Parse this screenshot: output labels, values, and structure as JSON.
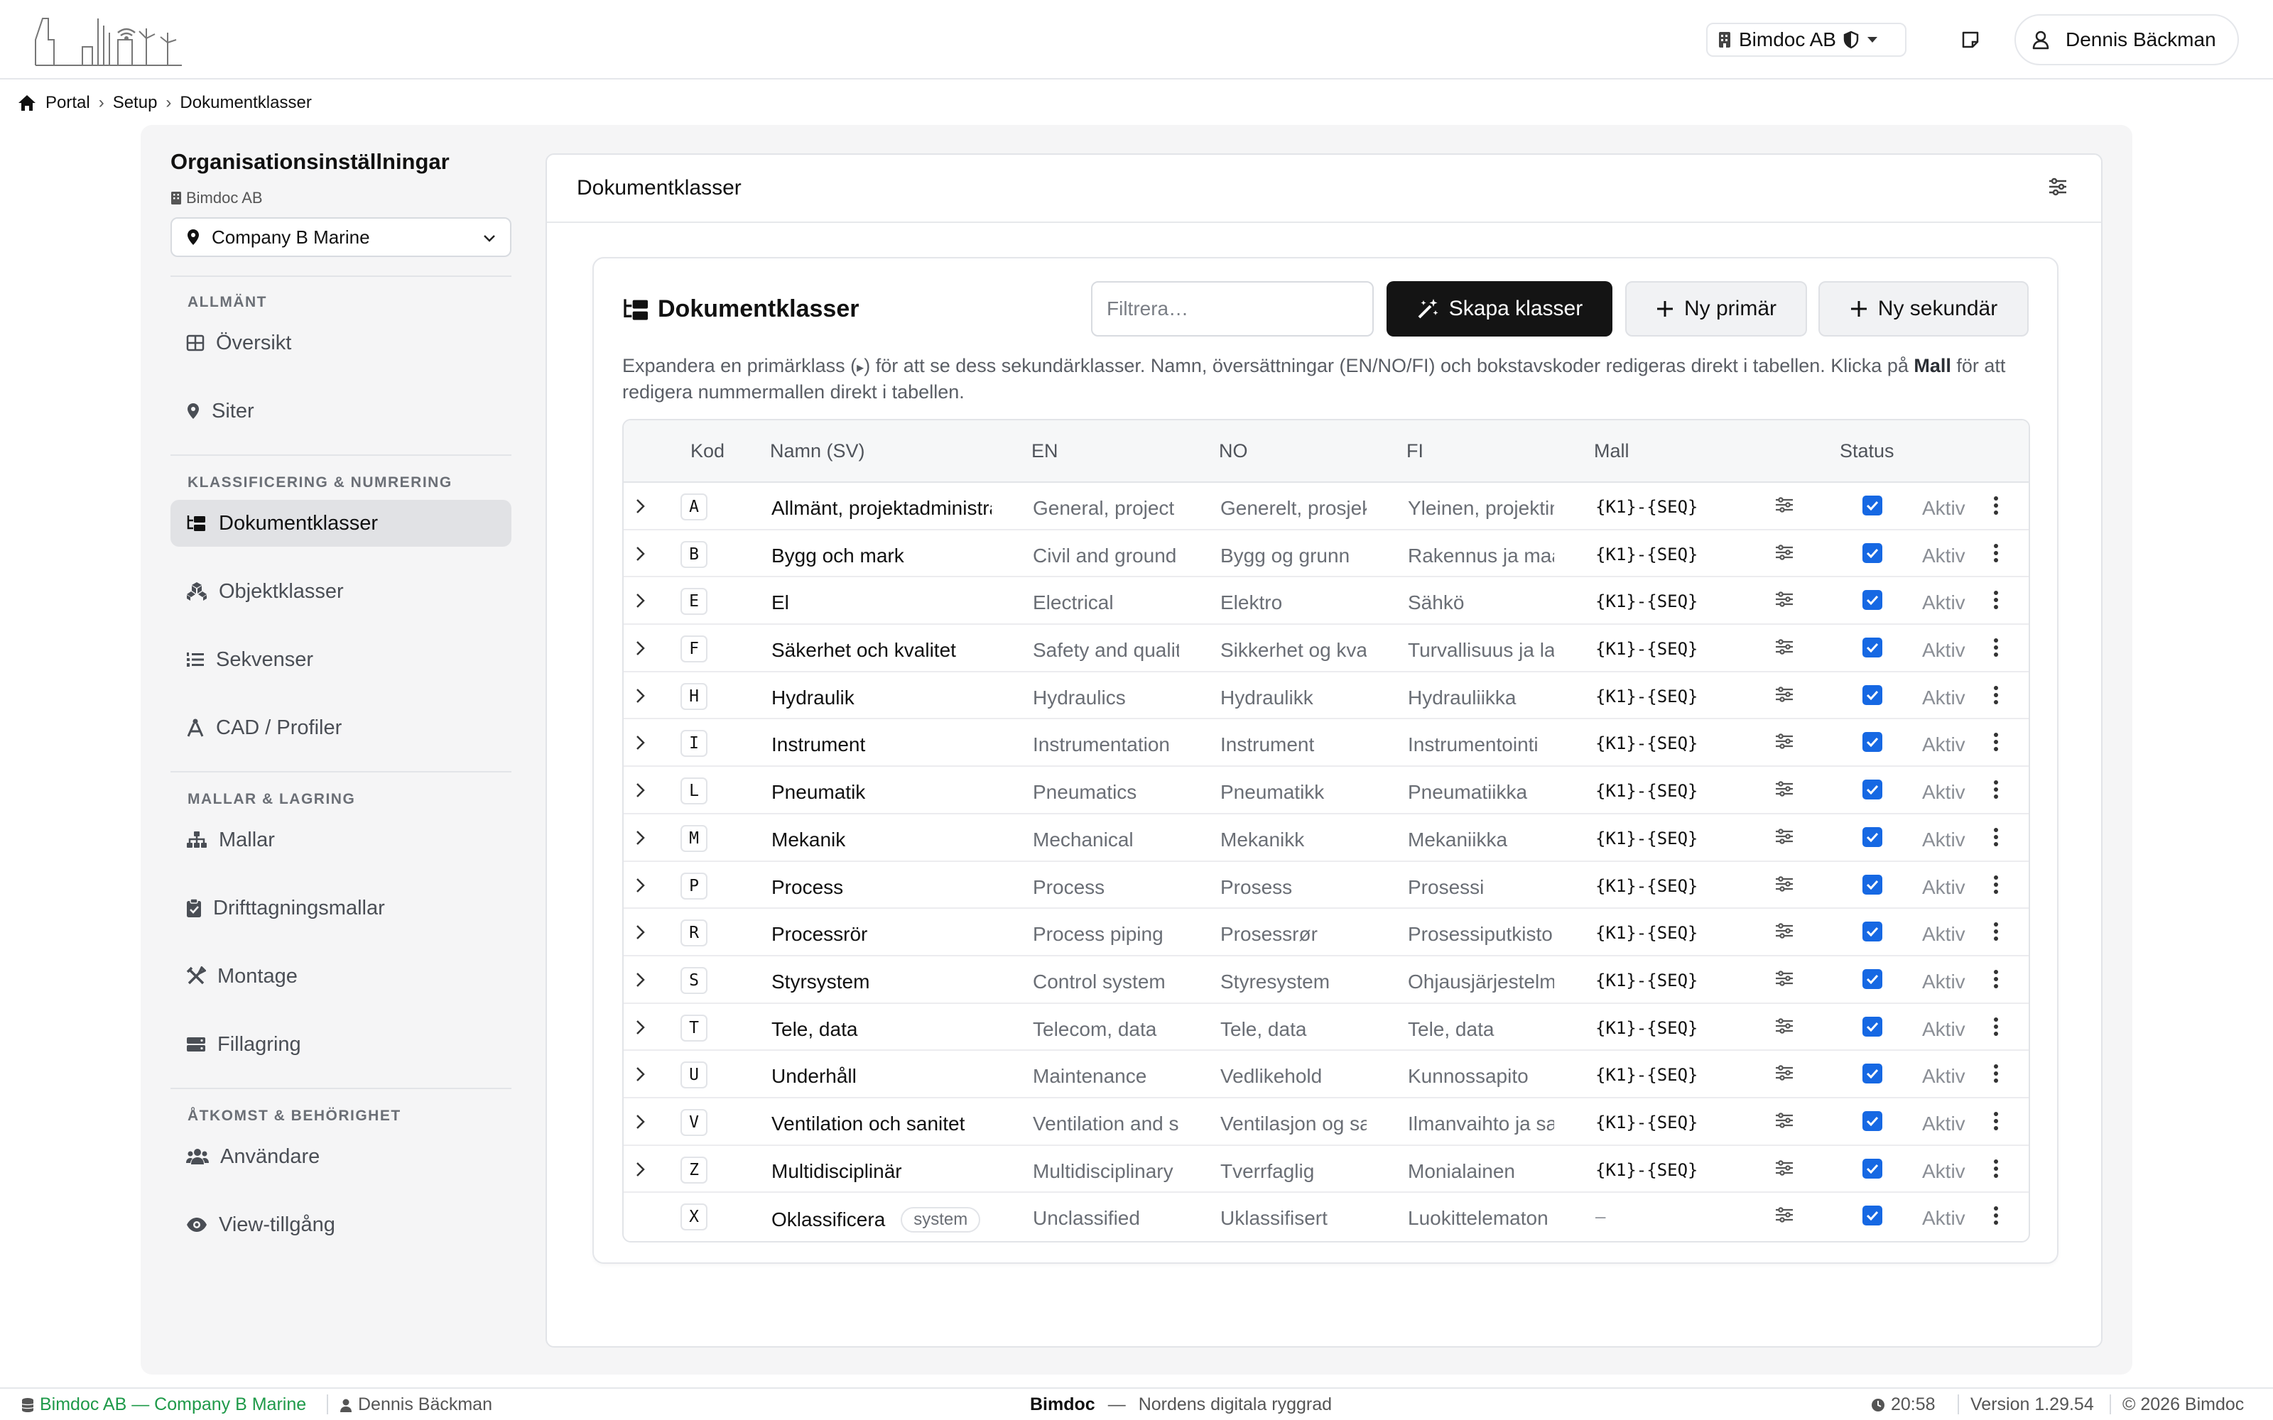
{
  "topbar": {
    "org_label": "Bimdoc AB",
    "user_label": "Dennis Bäckman"
  },
  "breadcrumb": [
    "Portal",
    "Setup",
    "Dokumentklasser"
  ],
  "sidebar": {
    "title": "Organisationsinställningar",
    "org": "Bimdoc AB",
    "selected_company": "Company B Marine",
    "sections": [
      {
        "label": "ALLMÄNT",
        "items": [
          {
            "label": "Översikt",
            "icon": "grid-icon"
          },
          {
            "label": "Siter",
            "icon": "location-pin-icon"
          }
        ]
      },
      {
        "label": "KLASSIFICERING & NUMRERING",
        "items": [
          {
            "label": "Dokumentklasser",
            "icon": "folder-tree-icon",
            "active": true
          },
          {
            "label": "Objektklasser",
            "icon": "cubes-icon"
          },
          {
            "label": "Sekvenser",
            "icon": "numbered-list-icon"
          },
          {
            "label": "CAD / Profiler",
            "icon": "compass-drafting-icon"
          }
        ]
      },
      {
        "label": "MALLAR & LAGRING",
        "items": [
          {
            "label": "Mallar",
            "icon": "sitemap-icon"
          },
          {
            "label": "Drifttagningsmallar",
            "icon": "clipboard-check-icon"
          },
          {
            "label": "Montage",
            "icon": "tools-icon"
          },
          {
            "label": "Fillagring",
            "icon": "hard-drive-icon"
          }
        ]
      },
      {
        "label": "ÅTKOMST & BEHÖRIGHET",
        "items": [
          {
            "label": "Användare",
            "icon": "users-icon"
          },
          {
            "label": "View-tillgång",
            "icon": "eye-icon"
          }
        ]
      }
    ]
  },
  "main": {
    "header_title": "Dokumentklasser",
    "card_title": "Dokumentklasser",
    "filter_placeholder": "Filtrera…",
    "buttons": {
      "create": "Skapa klasser",
      "new_primary": "Ny primär",
      "new_secondary": "Ny sekundär"
    },
    "help_text_1": "Expandera en primärklass (",
    "help_text_arrow": "▸",
    "help_text_2": ") för att se dess sekundärklasser. Namn, översättningar (EN/NO/FI) och bokstavskoder redigeras direkt i tabellen. Klicka på ",
    "help_text_bold": "Mall",
    "help_text_3": " för att redigera nummermallen direkt i tabellen.",
    "columns": {
      "code": "Kod",
      "name": "Namn (SV)",
      "en": "EN",
      "no": "NO",
      "fi": "FI",
      "template": "Mall",
      "status": "Status"
    },
    "rows": [
      {
        "code": "A",
        "name": "Allmänt, projektadministration",
        "en": "General, project",
        "no": "Generelt, prosjekt",
        "fi": "Yleinen, projektin",
        "template": "{K1}-{SEQ}",
        "status": "Aktiv",
        "expandable": true
      },
      {
        "code": "B",
        "name": "Bygg och mark",
        "en": "Civil and ground",
        "no": "Bygg og grunn",
        "fi": "Rakennus ja maa",
        "template": "{K1}-{SEQ}",
        "status": "Aktiv",
        "expandable": true
      },
      {
        "code": "E",
        "name": "El",
        "en": "Electrical",
        "no": "Elektro",
        "fi": "Sähkö",
        "template": "{K1}-{SEQ}",
        "status": "Aktiv",
        "expandable": true
      },
      {
        "code": "F",
        "name": "Säkerhet och kvalitet",
        "en": "Safety and quality",
        "no": "Sikkerhet og kvalitet",
        "fi": "Turvallisuus ja laatu",
        "template": "{K1}-{SEQ}",
        "status": "Aktiv",
        "expandable": true
      },
      {
        "code": "H",
        "name": "Hydraulik",
        "en": "Hydraulics",
        "no": "Hydraulikk",
        "fi": "Hydrauliikka",
        "template": "{K1}-{SEQ}",
        "status": "Aktiv",
        "expandable": true
      },
      {
        "code": "I",
        "name": "Instrument",
        "en": "Instrumentation",
        "no": "Instrument",
        "fi": "Instrumentointi",
        "template": "{K1}-{SEQ}",
        "status": "Aktiv",
        "expandable": true
      },
      {
        "code": "L",
        "name": "Pneumatik",
        "en": "Pneumatics",
        "no": "Pneumatikk",
        "fi": "Pneumatiikka",
        "template": "{K1}-{SEQ}",
        "status": "Aktiv",
        "expandable": true
      },
      {
        "code": "M",
        "name": "Mekanik",
        "en": "Mechanical",
        "no": "Mekanikk",
        "fi": "Mekaniikka",
        "template": "{K1}-{SEQ}",
        "status": "Aktiv",
        "expandable": true
      },
      {
        "code": "P",
        "name": "Process",
        "en": "Process",
        "no": "Prosess",
        "fi": "Prosessi",
        "template": "{K1}-{SEQ}",
        "status": "Aktiv",
        "expandable": true
      },
      {
        "code": "R",
        "name": "Processrör",
        "en": "Process piping",
        "no": "Prosessrør",
        "fi": "Prosessiputkisto",
        "template": "{K1}-{SEQ}",
        "status": "Aktiv",
        "expandable": true
      },
      {
        "code": "S",
        "name": "Styrsystem",
        "en": "Control system",
        "no": "Styresystem",
        "fi": "Ohjausjärjestelmä",
        "template": "{K1}-{SEQ}",
        "status": "Aktiv",
        "expandable": true
      },
      {
        "code": "T",
        "name": "Tele, data",
        "en": "Telecom, data",
        "no": "Tele, data",
        "fi": "Tele, data",
        "template": "{K1}-{SEQ}",
        "status": "Aktiv",
        "expandable": true
      },
      {
        "code": "U",
        "name": "Underhåll",
        "en": "Maintenance",
        "no": "Vedlikehold",
        "fi": "Kunnossapito",
        "template": "{K1}-{SEQ}",
        "status": "Aktiv",
        "expandable": true
      },
      {
        "code": "V",
        "name": "Ventilation och sanitet",
        "en": "Ventilation and sanitation",
        "no": "Ventilasjon og sanitær",
        "fi": "Ilmanvaihto ja saniteetti",
        "template": "{K1}-{SEQ}",
        "status": "Aktiv",
        "expandable": true
      },
      {
        "code": "Z",
        "name": "Multidisciplinär",
        "en": "Multidisciplinary",
        "no": "Tverrfaglig",
        "fi": "Monialainen",
        "template": "{K1}-{SEQ}",
        "status": "Aktiv",
        "expandable": true
      },
      {
        "code": "X",
        "name": "Oklassificera",
        "badge": "system",
        "en": "Unclassified",
        "no": "Uklassifisert",
        "fi": "Luokittelematon",
        "template": "–",
        "status": "Aktiv",
        "expandable": false
      }
    ]
  },
  "footer": {
    "org_company": "Bimdoc AB — Company B Marine",
    "user": "Dennis Bäckman",
    "brand": "Bimdoc",
    "dash": "—",
    "tagline": "Nordens digitala ryggrad",
    "time": "20:58",
    "version": "Version 1.29.54",
    "copyright": "© 2026 Bimdoc"
  },
  "colors": {
    "accent_dark": "#141414",
    "checkbox_blue": "#1668e3",
    "footer_green": "#1f9a4a"
  }
}
